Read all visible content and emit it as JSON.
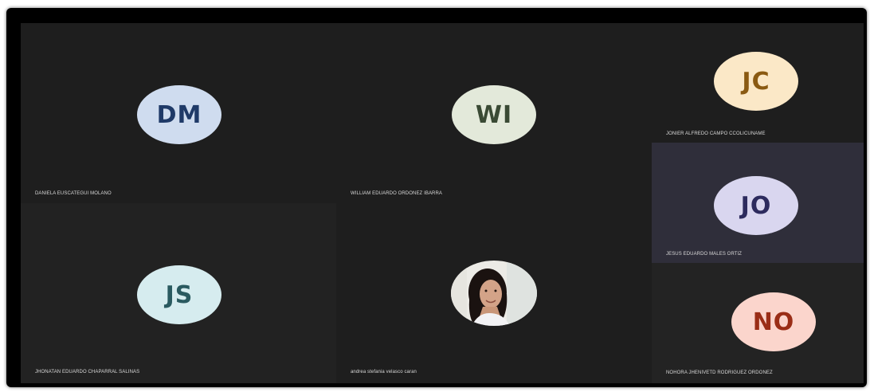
{
  "participants": [
    {
      "initials": "DM",
      "name": "DANIELA EUSCATEGUI MOLANO",
      "avatar_bg": "#cfdcef",
      "text_color": "#1f3a68"
    },
    {
      "initials": "WI",
      "name": "WILLIAM EDUARDO ORDONEZ IBARRA",
      "avatar_bg": "#e3e9da",
      "text_color": "#3a4a34"
    },
    {
      "initials": "JC",
      "name": "JONIER ALFREDO CAMPO CCOLICUNAME",
      "avatar_bg": "#fbe8c7",
      "text_color": "#8a5a12"
    },
    {
      "initials": "JO",
      "name": "JESUS EDUARDO MALES ORTIZ",
      "avatar_bg": "#d9d6ef",
      "text_color": "#2d2b5e"
    },
    {
      "initials": "JS",
      "name": "JHONATAN EDUARDO CHAPARRAL SALINAS",
      "avatar_bg": "#d6ecef",
      "text_color": "#2a5a60"
    },
    {
      "initials": "",
      "name": "andrea stefania velasco caran",
      "avatar_bg": "#ecebe6",
      "text_color": "#000000",
      "photo": "profile-photo"
    },
    {
      "initials": "NO",
      "name": "NOHORA JHENIVETD RODRIGUEZ ORDONEZ",
      "avatar_bg": "#fbd5cc",
      "text_color": "#9a2d16"
    }
  ],
  "colors": {
    "tile_bg": "#1e1e1e",
    "tile_bg_alt": "#222222",
    "tile_active_bg": "#2f2e3a",
    "frame_bg": "#000000"
  }
}
